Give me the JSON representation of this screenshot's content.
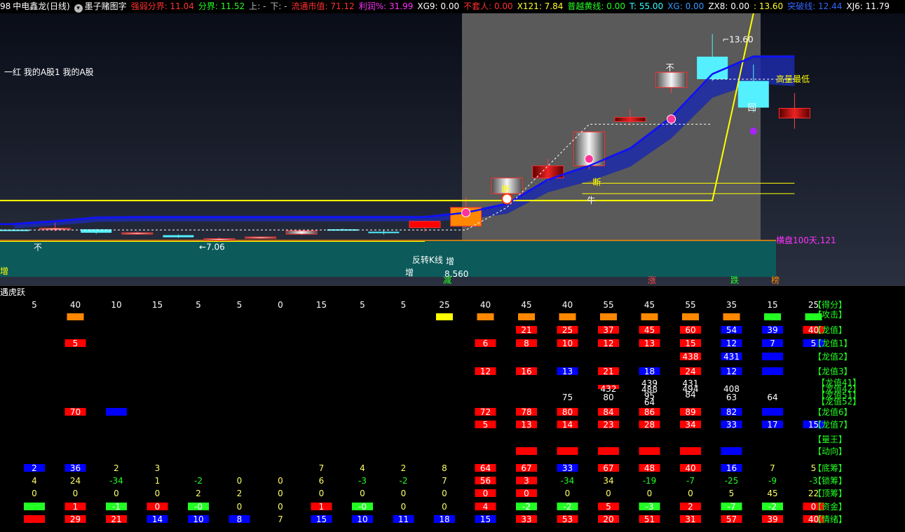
{
  "header": {
    "code_fragment": "98",
    "stock_name": "中电鑫龙",
    "period": "(日线)",
    "dropdown_icon": "circle-chevron-down-icon",
    "formula_name": "墨子赌图字",
    "indicators": [
      {
        "label": "强弱分界:",
        "value": "11.04",
        "color": "#ff3030"
      },
      {
        "label": "分界:",
        "value": "11.52",
        "color": "#22ff22"
      },
      {
        "label": "上:",
        "value": "-",
        "color": "#bbbbbb"
      },
      {
        "label": "下:",
        "value": "-",
        "color": "#bbbbbb"
      },
      {
        "label": "流通市值:",
        "value": "71.12",
        "color": "#ff3030"
      },
      {
        "label": "利润%:",
        "value": "31.99",
        "color": "#ff33ff"
      },
      {
        "label": "XG9:",
        "value": "0.00",
        "color": "#ffffff"
      },
      {
        "label": "不套人:",
        "value": "0.00",
        "color": "#ff3030"
      },
      {
        "label": "X121:",
        "value": "7.84",
        "color": "#ffff33"
      },
      {
        "label": "普越黄线:",
        "value": "0.00",
        "color": "#22ff22"
      },
      {
        "label": "T:",
        "value": "55.00",
        "color": "#33ffff"
      },
      {
        "label": "XG:",
        "value": "0.00",
        "color": "#3399ff"
      },
      {
        "label": "ZX8:",
        "value": "0.00",
        "color": "#ffffff"
      },
      {
        "label": ":",
        "value": "13.60",
        "color": "#ffff33"
      },
      {
        "label": "突破线:",
        "value": "12.44",
        "color": "#3366ff"
      },
      {
        "label": "XJ6:",
        "value": "11.79",
        "color": "#ffffff"
      }
    ]
  },
  "main": {
    "left_label": "一红 我的A股1 我的A股",
    "high_label": "13.60",
    "low_label": "←7.06",
    "price_label": "8.560",
    "high_low_label": "高量最低",
    "consolidation_label": "横盘100天,121",
    "reverse_label": "反转K线",
    "markers": {
      "zeng": "增",
      "jian": "减",
      "zhang": "涨",
      "die": "跌",
      "bang": "榜",
      "duan": "断",
      "niu": "牛",
      "bu": "不",
      "hui": "回"
    },
    "colors": {
      "yellow": "#ffff00",
      "blue": "#1010ff",
      "teal": "#0c5a5a",
      "gray": "#5a5a5a",
      "cyan": "#55f0ff",
      "red": "#ff0000",
      "orange": "#ff8800"
    }
  },
  "chart_data": {
    "type": "candlestick",
    "title": "中电鑫龙 (日线)",
    "candles": [
      {
        "o": 7.96,
        "h": 7.97,
        "l": 7.92,
        "c": 7.96,
        "color": "cyan"
      },
      {
        "o": 8.0,
        "h": 8.16,
        "l": 7.91,
        "c": 8.0,
        "color": "hollow"
      },
      {
        "o": 7.97,
        "h": 7.98,
        "l": 7.84,
        "c": 7.87,
        "color": "cyan"
      },
      {
        "o": 7.87,
        "h": 7.91,
        "l": 7.85,
        "c": 7.86,
        "color": "hollow"
      },
      {
        "o": 7.8,
        "h": 7.82,
        "l": 7.72,
        "c": 7.74,
        "color": "cyan"
      },
      {
        "o": 7.7,
        "h": 7.74,
        "l": 7.63,
        "c": 7.66,
        "color": "hollow"
      },
      {
        "o": 7.75,
        "h": 7.76,
        "l": 7.72,
        "c": 7.73,
        "color": "hollow"
      },
      {
        "o": 7.83,
        "h": 7.94,
        "l": 7.8,
        "c": 7.93,
        "color": "hollow"
      },
      {
        "o": 7.97,
        "h": 7.99,
        "l": 7.93,
        "c": 7.95,
        "color": "cyan"
      },
      {
        "o": 7.9,
        "h": 7.95,
        "l": 7.82,
        "c": 7.9,
        "color": "cyan"
      },
      {
        "o": 8.02,
        "h": 8.22,
        "l": 7.9,
        "c": 8.2,
        "color": "red"
      },
      {
        "o": 8.06,
        "h": 8.9,
        "l": 8.05,
        "c": 8.6,
        "color": "orange"
      },
      {
        "o": 9.0,
        "h": 9.45,
        "l": 9.0,
        "c": 9.45,
        "color": "hollow"
      },
      {
        "o": 9.45,
        "h": 10.0,
        "l": 9.35,
        "c": 9.8,
        "color": "dark-red"
      },
      {
        "o": 9.8,
        "h": 10.8,
        "l": 9.7,
        "c": 10.78,
        "color": "hollow"
      },
      {
        "o": 11.08,
        "h": 11.43,
        "l": 10.96,
        "c": 11.2,
        "color": "dark-red"
      },
      {
        "o": 12.06,
        "h": 12.5,
        "l": 11.9,
        "c": 12.5,
        "color": "hollow"
      },
      {
        "o": 12.3,
        "h": 13.6,
        "l": 12.25,
        "c": 12.95,
        "color": "cyan"
      },
      {
        "o": 12.25,
        "h": 12.72,
        "l": 11.34,
        "c": 11.48,
        "color": "cyan"
      },
      {
        "o": 11.46,
        "h": 11.9,
        "l": 10.87,
        "c": 11.18,
        "color": "dark-red"
      }
    ],
    "ylim": [
      6.8,
      14.2
    ],
    "yellow_line_levels": [
      8.8,
      8.8,
      8.8,
      8.8,
      8.8,
      8.8,
      8.8,
      8.8,
      8.8,
      8.8,
      8.8,
      8.8,
      8.8,
      8.8,
      8.8,
      8.8,
      8.8,
      8.8,
      14.2
    ],
    "blue_line": [
      8.12,
      8.2,
      8.3,
      8.32,
      8.32,
      8.32,
      8.32,
      8.32,
      8.32,
      8.32,
      8.32,
      8.45,
      8.7,
      9.4,
      9.8,
      10.3,
      11.2,
      12.45,
      12.95,
      12.95
    ],
    "sub_rows": [
      {
        "name": "【得分】",
        "cells": [
          "5",
          "40",
          "10",
          "15",
          "5",
          "5",
          "0",
          "15",
          "5",
          "5",
          "25",
          "40",
          "45",
          "40",
          "55",
          "45",
          "55",
          "35",
          "15",
          "25"
        ],
        "style": "text"
      },
      {
        "name": "【攻击】",
        "cells": [
          "",
          "o",
          "",
          "",
          "",
          "",
          "",
          "",
          "",
          "",
          "y",
          "o",
          "o",
          "o",
          "o",
          "o",
          "o",
          "o",
          "g",
          "g"
        ],
        "style": "block"
      },
      {
        "name": "【龙值】",
        "cells": [
          "",
          "",
          "",
          "",
          "",
          "",
          "",
          "",
          "",
          "",
          "",
          "",
          "21",
          "25",
          "37",
          "45",
          "60",
          "54",
          "39",
          "40"
        ],
        "colors": [
          "",
          "",
          "",
          "",
          "",
          "",
          "",
          "",
          "",
          "",
          "",
          "",
          "r",
          "r",
          "r",
          "r",
          "r",
          "b",
          "b",
          "r"
        ]
      },
      {
        "name": "【龙值1】",
        "cells": [
          "",
          "5",
          "",
          "",
          "",
          "",
          "",
          "",
          "",
          "",
          "",
          "6",
          "8",
          "10",
          "12",
          "13",
          "15",
          "12",
          "7",
          "5"
        ],
        "colors": [
          "",
          "r",
          "",
          "",
          "",
          "",
          "",
          "",
          "",
          "",
          "",
          "r",
          "r",
          "r",
          "r",
          "r",
          "r",
          "b",
          "b",
          "b"
        ]
      },
      {
        "name": "【龙值2】",
        "cells": [
          "",
          "",
          "",
          "",
          "",
          "",
          "",
          "",
          "",
          "",
          "",
          "",
          "",
          "",
          "",
          "",
          "438",
          "431",
          "",
          ""
        ],
        "colors": [
          "",
          "",
          "",
          "",
          "",
          "",
          "",
          "",
          "",
          "",
          "",
          "",
          "",
          "",
          "",
          "",
          "r",
          "b",
          "b",
          ""
        ]
      },
      {
        "name": "【龙值3】",
        "cells": [
          "",
          "",
          "",
          "",
          "",
          "",
          "",
          "",
          "",
          "",
          "",
          "12",
          "16",
          "13",
          "21",
          "18",
          "24",
          "12",
          "",
          ""
        ],
        "colors": [
          "",
          "",
          "",
          "",
          "",
          "",
          "",
          "",
          "",
          "",
          "",
          "r",
          "r",
          "b",
          "r",
          "b",
          "r",
          "b",
          "b",
          ""
        ]
      },
      {
        "name": "【龙值6】",
        "cells": [
          "",
          "70",
          "",
          "",
          "",
          "",
          "",
          "",
          "",
          "",
          "",
          "72",
          "78",
          "80",
          "84",
          "86",
          "89",
          "82",
          "",
          ""
        ],
        "colors": [
          "",
          "r",
          "b",
          "",
          "",
          "",
          "",
          "",
          "",
          "",
          "",
          "r",
          "r",
          "r",
          "r",
          "r",
          "r",
          "b",
          "b",
          ""
        ]
      },
      {
        "name": "【龙值7】",
        "cells": [
          "",
          "",
          "",
          "",
          "",
          "",
          "",
          "",
          "",
          "",
          "",
          "5",
          "13",
          "14",
          "23",
          "28",
          "34",
          "33",
          "17",
          "15"
        ],
        "colors": [
          "",
          "",
          "",
          "",
          "",
          "",
          "",
          "",
          "",
          "",
          "",
          "r",
          "r",
          "r",
          "r",
          "r",
          "r",
          "b",
          "b",
          "b"
        ]
      },
      {
        "name": "【动向】",
        "cells": [
          "",
          "",
          "",
          "",
          "",
          "",
          "",
          "",
          "",
          "",
          "",
          "",
          "",
          "",
          "",
          "",
          "",
          "",
          "",
          ""
        ],
        "colors": [
          "",
          "",
          "",
          "",
          "",
          "",
          "",
          "",
          "",
          "",
          "",
          "",
          "r",
          "r",
          "r",
          "r",
          "r",
          "b",
          "",
          ""
        ]
      },
      {
        "name": "【底筹】",
        "cells": [
          "2",
          "36",
          "2",
          "3",
          "",
          "",
          "",
          "7",
          "4",
          "2",
          "8",
          "64",
          "67",
          "33",
          "67",
          "48",
          "40",
          "16",
          "7",
          "5"
        ],
        "colors": [
          "b",
          "b",
          "",
          "",
          "",
          "",
          "",
          "",
          "",
          "",
          "",
          "r",
          "r",
          "b",
          "r",
          "r",
          "r",
          "b",
          "",
          ""
        ]
      },
      {
        "name": "【锁筹】",
        "cells": [
          "4",
          "24",
          "-34",
          "1",
          "-2",
          "0",
          "0",
          "6",
          "-3",
          "-2",
          "7",
          "56",
          "3",
          "-34",
          "34",
          "-19",
          "-7",
          "-25",
          "-9",
          "-3"
        ],
        "colors": [
          "",
          "",
          "",
          "",
          "",
          "",
          "",
          "",
          "",
          "",
          "",
          "r",
          "r",
          "",
          "",
          "",
          "",
          "",
          "",
          ""
        ]
      },
      {
        "name": "【顶筹】",
        "cells": [
          "0",
          "0",
          "0",
          "0",
          "2",
          "2",
          "0",
          "0",
          "0",
          "0",
          "0",
          "0",
          "0",
          "0",
          "0",
          "0",
          "0",
          "5",
          "45",
          "22"
        ],
        "colors": [
          "",
          "",
          "",
          "",
          "",
          "",
          "",
          "",
          "",
          "",
          "",
          "r",
          "r",
          "",
          "",
          "",
          "",
          "",
          "",
          ""
        ]
      },
      {
        "name": "【资金】",
        "cells": [
          "",
          "1",
          "-1",
          "0",
          "-0",
          "0",
          "0",
          "1",
          "-0",
          "0",
          "0",
          "4",
          "-2",
          "-2",
          "5",
          "-3",
          "2",
          "-7",
          "-2",
          "0"
        ],
        "colors": [
          "g",
          "r",
          "g",
          "r",
          "g",
          "",
          "",
          "r",
          "g",
          "",
          "",
          "r",
          "g",
          "g",
          "r",
          "g",
          "r",
          "g",
          "g",
          "r"
        ]
      },
      {
        "name": "【情绪】",
        "cells": [
          "",
          "29",
          "21",
          "14",
          "10",
          "8",
          "7",
          "15",
          "10",
          "11",
          "18",
          "15",
          "33",
          "53",
          "20",
          "51",
          "31",
          "57",
          "39",
          "40"
        ],
        "colors": [
          "r",
          "r",
          "r",
          "b",
          "b",
          "b",
          "",
          "b",
          "b",
          "b",
          "b",
          "b",
          "r",
          "r",
          "r",
          "r",
          "r",
          "r",
          "r",
          "r"
        ]
      }
    ],
    "dragon_cluster": {
      "cells_col14": "432",
      "cells_col15": [
        "439",
        "488",
        "95",
        "64"
      ],
      "cells_col16": [
        "431",
        "494",
        "84"
      ],
      "cells_col17": [
        "408",
        "63"
      ],
      "cells_col18": [
        "",
        "64"
      ],
      "extra_col13": "75",
      "extra_col14": "80",
      "labels": [
        "【龙值41】",
        "【龙值42】",
        "【龙值51】",
        "【龙值52】"
      ]
    },
    "sub_title": "遇虎跃",
    "extra_label": "【量王】"
  }
}
